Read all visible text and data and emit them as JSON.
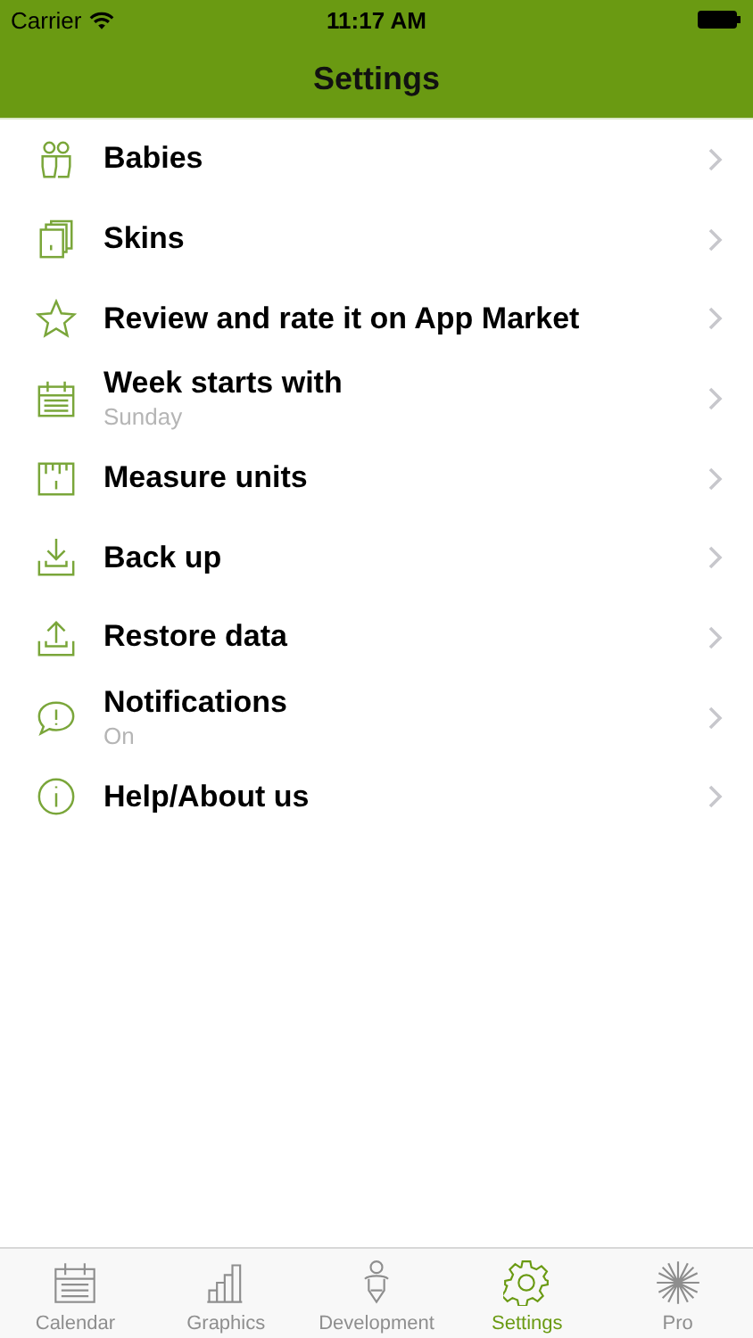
{
  "status_bar": {
    "carrier": "Carrier",
    "time": "11:17 AM"
  },
  "nav_bar": {
    "title": "Settings"
  },
  "settings": [
    {
      "label": "Babies"
    },
    {
      "label": "Skins"
    },
    {
      "label": "Review and rate it on App Market"
    },
    {
      "label": "Week starts with",
      "detail": "Sunday"
    },
    {
      "label": "Measure units"
    },
    {
      "label": "Back up"
    },
    {
      "label": "Restore data"
    },
    {
      "label": "Notifications",
      "detail": "On"
    },
    {
      "label": "Help/About us"
    }
  ],
  "tab_bar": [
    {
      "label": "Calendar",
      "selected": false
    },
    {
      "label": "Graphics",
      "selected": false
    },
    {
      "label": "Development",
      "selected": false
    },
    {
      "label": "Settings",
      "selected": true
    },
    {
      "label": "Pro",
      "selected": false
    }
  ]
}
